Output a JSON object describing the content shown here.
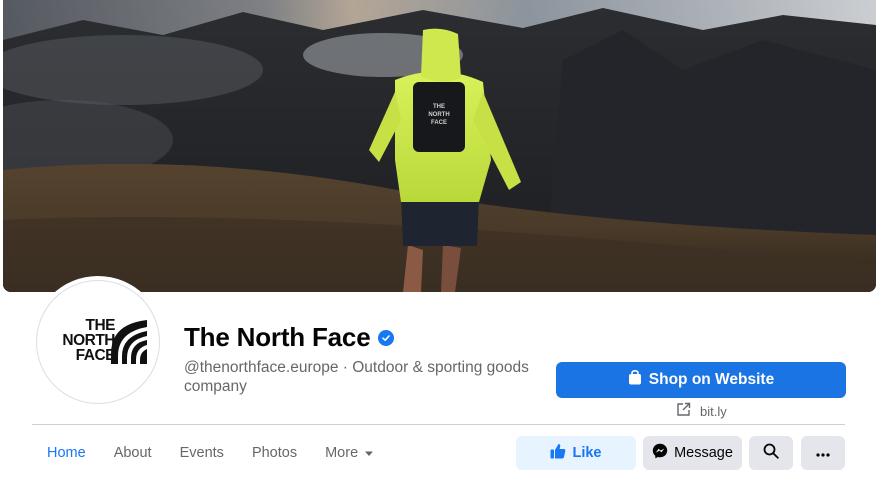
{
  "page": {
    "name": "The North Face",
    "verified": true,
    "handle_and_category": "@thenorthface.europe · Outdoor & sporting goods company",
    "logo_text": [
      "THE",
      "NORTH",
      "FACE"
    ]
  },
  "cta": {
    "shop_label": "Shop on Website",
    "link_text": "bit.ly"
  },
  "nav": {
    "items": [
      {
        "label": "Home",
        "active": true
      },
      {
        "label": "About"
      },
      {
        "label": "Events"
      },
      {
        "label": "Photos"
      },
      {
        "label": "More"
      }
    ]
  },
  "actions": {
    "like_label": "Like",
    "message_label": "Message"
  },
  "colors": {
    "accent": "#1877f2",
    "shop_button": "#1b74e4",
    "like_bg": "#e7f3ff",
    "secondary_bg": "#e4e6eb",
    "muted_text": "#65676b"
  },
  "icons": {
    "verified": "verified-badge-icon",
    "shop": "shopping-bag-icon",
    "link": "external-link-icon",
    "more_dropdown": "caret-down-icon",
    "like": "thumbs-up-icon",
    "message": "messenger-icon",
    "search": "search-icon",
    "more": "ellipsis-icon"
  }
}
